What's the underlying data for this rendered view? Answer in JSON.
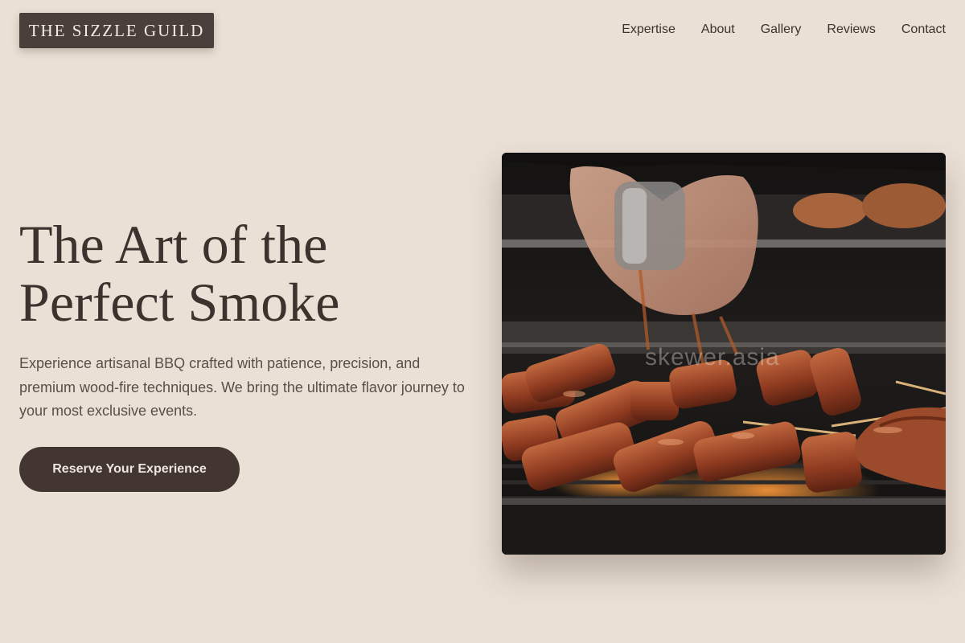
{
  "brand": {
    "name": "THE SIZZLE GUILD"
  },
  "nav": {
    "items": [
      {
        "label": "Expertise"
      },
      {
        "label": "About"
      },
      {
        "label": "Gallery"
      },
      {
        "label": "Reviews"
      },
      {
        "label": "Contact"
      }
    ]
  },
  "hero": {
    "title_line1": "The Art of the",
    "title_line2": "Perfect Smoke",
    "subtitle": "Experience artisanal BBQ crafted with patience, precision, and premium wood-fire techniques. We bring the ultimate flavor journey to your most exclusive events.",
    "cta_label": "Reserve Your Experience"
  },
  "image": {
    "watermark": "skewer.asia"
  },
  "colors": {
    "background": "#ebe0d6",
    "brand_dark": "#4a3f3a",
    "button": "#433631",
    "text": "#3d322d"
  }
}
